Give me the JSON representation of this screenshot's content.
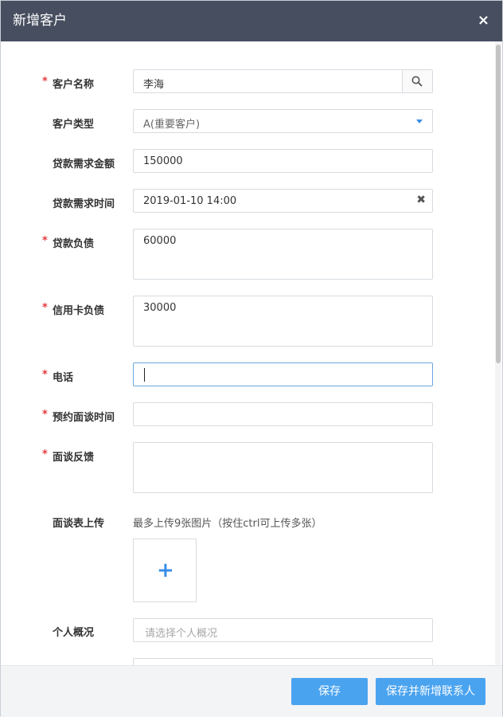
{
  "dialog": {
    "title": "新增客户",
    "close_symbol": "×"
  },
  "form": {
    "customer_name": {
      "label": "客户名称",
      "required": "*",
      "value": "李海"
    },
    "customer_type": {
      "label": "客户类型",
      "value": "A(重要客户)"
    },
    "loan_amount": {
      "label": "贷款需求金额",
      "value": "150000"
    },
    "loan_time": {
      "label": "贷款需求时间",
      "value": "2019-01-10 14:00",
      "clear_symbol": "✖"
    },
    "loan_debt": {
      "label": "贷款负债",
      "required": "*",
      "value": "60000"
    },
    "credit_debt": {
      "label": "信用卡负债",
      "required": "*",
      "value": "30000"
    },
    "phone": {
      "label": "电话",
      "required": "*",
      "value": ""
    },
    "appointment_time": {
      "label": "预约面谈时间",
      "required": "*",
      "value": ""
    },
    "interview_feedback": {
      "label": "面谈反馈",
      "required": "*",
      "value": ""
    },
    "interview_upload": {
      "label": "面谈表上传",
      "hint": "最多上传9张图片（按住ctrl可上传多张）",
      "plus": "+"
    },
    "personal_overview": {
      "label": "个人概况",
      "placeholder": "请选择个人概况"
    }
  },
  "footer": {
    "save_label": "保存",
    "save_add_contact_label": "保存并新增联系人"
  },
  "colors": {
    "header": "#474e60",
    "accent": "#4aa3ef",
    "required": "#e4393c"
  }
}
